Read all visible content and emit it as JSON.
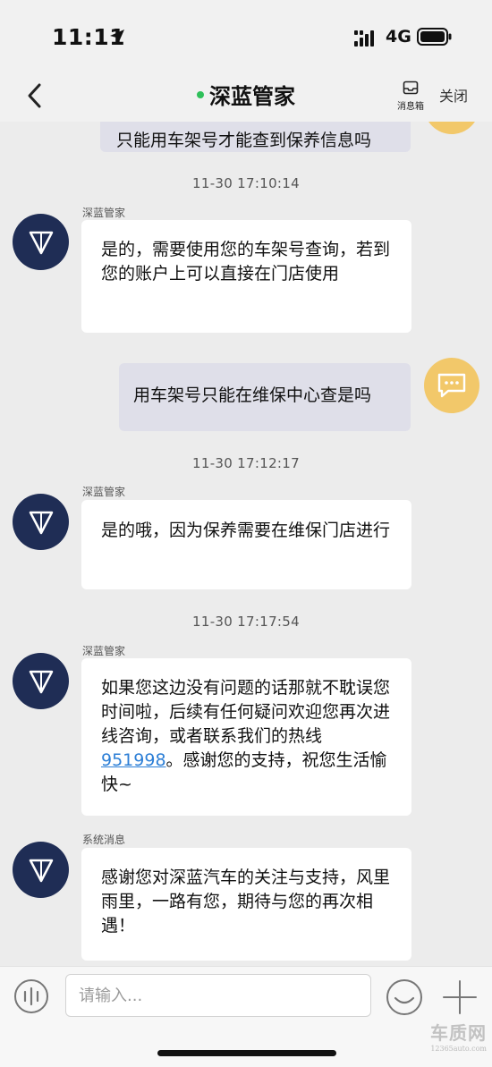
{
  "status_bar": {
    "time": "11:11",
    "network": "4G"
  },
  "nav": {
    "title": "深蓝管家",
    "inbox_label": "消息箱",
    "close_label": "关闭"
  },
  "messages": {
    "partial_user_text": "只能用车架号才能查到保养信息吗",
    "t1": "11-30 17:10:14",
    "m1_sender": "深蓝管家",
    "m1_text": "是的，需要使用您的车架号查询，若到您的账户上可以直接在门店使用",
    "m2_text": "用车架号只能在维保中心查是吗",
    "t2": "11-30 17:12:17",
    "m3_sender": "深蓝管家",
    "m3_text": "是的哦，因为保养需要在维保门店进行",
    "t3": "11-30 17:17:54",
    "m4_sender": "深蓝管家",
    "m4_text_before": "如果您这边没有问题的话那就不耽误您时间啦，后续有任何疑问欢迎您再次进线咨询，或者联系我们的热线",
    "m4_hotline": "951998",
    "m4_text_after": "。感谢您的支持，祝您生活愉快~",
    "m5_sender": "系统消息",
    "m5_text": "感谢您对深蓝汽车的关注与支持，风里雨里，一路有您，期待与您的再次相遇！"
  },
  "input": {
    "placeholder": "请输入..."
  },
  "watermark": {
    "brand": "车质网",
    "site": "12365auto.com"
  },
  "colors": {
    "online": "#2fc05a",
    "hotline_link": "#2d7fd6",
    "user_bubble": "#dfdfe9",
    "agent_avatar": "#1f2d55",
    "user_avatar": "#f2c86a"
  },
  "icons": [
    "location-arrow-icon",
    "signal-icon",
    "battery-icon",
    "back-icon",
    "inbox-icon",
    "deepal-logo-icon",
    "chat-bubble-icon",
    "voice-icon",
    "emoji-icon",
    "plus-icon"
  ]
}
